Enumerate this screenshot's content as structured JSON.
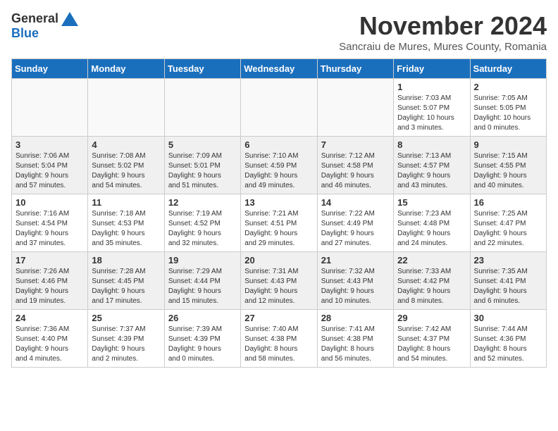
{
  "logo": {
    "general": "General",
    "blue": "Blue"
  },
  "title": "November 2024",
  "subtitle": "Sancraiu de Mures, Mures County, Romania",
  "headers": [
    "Sunday",
    "Monday",
    "Tuesday",
    "Wednesday",
    "Thursday",
    "Friday",
    "Saturday"
  ],
  "weeks": [
    [
      {
        "day": "",
        "detail": ""
      },
      {
        "day": "",
        "detail": ""
      },
      {
        "day": "",
        "detail": ""
      },
      {
        "day": "",
        "detail": ""
      },
      {
        "day": "",
        "detail": ""
      },
      {
        "day": "1",
        "detail": "Sunrise: 7:03 AM\nSunset: 5:07 PM\nDaylight: 10 hours\nand 3 minutes."
      },
      {
        "day": "2",
        "detail": "Sunrise: 7:05 AM\nSunset: 5:05 PM\nDaylight: 10 hours\nand 0 minutes."
      }
    ],
    [
      {
        "day": "3",
        "detail": "Sunrise: 7:06 AM\nSunset: 5:04 PM\nDaylight: 9 hours\nand 57 minutes."
      },
      {
        "day": "4",
        "detail": "Sunrise: 7:08 AM\nSunset: 5:02 PM\nDaylight: 9 hours\nand 54 minutes."
      },
      {
        "day": "5",
        "detail": "Sunrise: 7:09 AM\nSunset: 5:01 PM\nDaylight: 9 hours\nand 51 minutes."
      },
      {
        "day": "6",
        "detail": "Sunrise: 7:10 AM\nSunset: 4:59 PM\nDaylight: 9 hours\nand 49 minutes."
      },
      {
        "day": "7",
        "detail": "Sunrise: 7:12 AM\nSunset: 4:58 PM\nDaylight: 9 hours\nand 46 minutes."
      },
      {
        "day": "8",
        "detail": "Sunrise: 7:13 AM\nSunset: 4:57 PM\nDaylight: 9 hours\nand 43 minutes."
      },
      {
        "day": "9",
        "detail": "Sunrise: 7:15 AM\nSunset: 4:55 PM\nDaylight: 9 hours\nand 40 minutes."
      }
    ],
    [
      {
        "day": "10",
        "detail": "Sunrise: 7:16 AM\nSunset: 4:54 PM\nDaylight: 9 hours\nand 37 minutes."
      },
      {
        "day": "11",
        "detail": "Sunrise: 7:18 AM\nSunset: 4:53 PM\nDaylight: 9 hours\nand 35 minutes."
      },
      {
        "day": "12",
        "detail": "Sunrise: 7:19 AM\nSunset: 4:52 PM\nDaylight: 9 hours\nand 32 minutes."
      },
      {
        "day": "13",
        "detail": "Sunrise: 7:21 AM\nSunset: 4:51 PM\nDaylight: 9 hours\nand 29 minutes."
      },
      {
        "day": "14",
        "detail": "Sunrise: 7:22 AM\nSunset: 4:49 PM\nDaylight: 9 hours\nand 27 minutes."
      },
      {
        "day": "15",
        "detail": "Sunrise: 7:23 AM\nSunset: 4:48 PM\nDaylight: 9 hours\nand 24 minutes."
      },
      {
        "day": "16",
        "detail": "Sunrise: 7:25 AM\nSunset: 4:47 PM\nDaylight: 9 hours\nand 22 minutes."
      }
    ],
    [
      {
        "day": "17",
        "detail": "Sunrise: 7:26 AM\nSunset: 4:46 PM\nDaylight: 9 hours\nand 19 minutes."
      },
      {
        "day": "18",
        "detail": "Sunrise: 7:28 AM\nSunset: 4:45 PM\nDaylight: 9 hours\nand 17 minutes."
      },
      {
        "day": "19",
        "detail": "Sunrise: 7:29 AM\nSunset: 4:44 PM\nDaylight: 9 hours\nand 15 minutes."
      },
      {
        "day": "20",
        "detail": "Sunrise: 7:31 AM\nSunset: 4:43 PM\nDaylight: 9 hours\nand 12 minutes."
      },
      {
        "day": "21",
        "detail": "Sunrise: 7:32 AM\nSunset: 4:43 PM\nDaylight: 9 hours\nand 10 minutes."
      },
      {
        "day": "22",
        "detail": "Sunrise: 7:33 AM\nSunset: 4:42 PM\nDaylight: 9 hours\nand 8 minutes."
      },
      {
        "day": "23",
        "detail": "Sunrise: 7:35 AM\nSunset: 4:41 PM\nDaylight: 9 hours\nand 6 minutes."
      }
    ],
    [
      {
        "day": "24",
        "detail": "Sunrise: 7:36 AM\nSunset: 4:40 PM\nDaylight: 9 hours\nand 4 minutes."
      },
      {
        "day": "25",
        "detail": "Sunrise: 7:37 AM\nSunset: 4:39 PM\nDaylight: 9 hours\nand 2 minutes."
      },
      {
        "day": "26",
        "detail": "Sunrise: 7:39 AM\nSunset: 4:39 PM\nDaylight: 9 hours\nand 0 minutes."
      },
      {
        "day": "27",
        "detail": "Sunrise: 7:40 AM\nSunset: 4:38 PM\nDaylight: 8 hours\nand 58 minutes."
      },
      {
        "day": "28",
        "detail": "Sunrise: 7:41 AM\nSunset: 4:38 PM\nDaylight: 8 hours\nand 56 minutes."
      },
      {
        "day": "29",
        "detail": "Sunrise: 7:42 AM\nSunset: 4:37 PM\nDaylight: 8 hours\nand 54 minutes."
      },
      {
        "day": "30",
        "detail": "Sunrise: 7:44 AM\nSunset: 4:36 PM\nDaylight: 8 hours\nand 52 minutes."
      }
    ]
  ]
}
